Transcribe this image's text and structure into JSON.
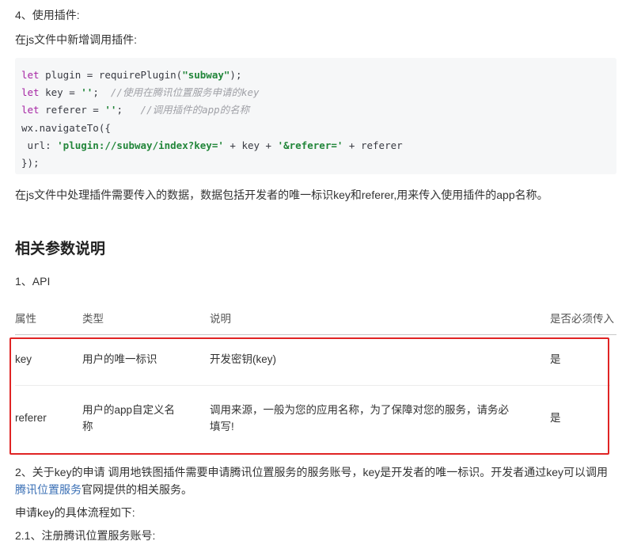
{
  "step4": {
    "title": "4、使用插件:",
    "desc": "在js文件中新增调用插件:"
  },
  "code": {
    "lines": [
      [
        {
          "t": "kw",
          "v": "let"
        },
        {
          "t": "p",
          "v": " plugin = requirePlugin("
        },
        {
          "t": "str",
          "v": "\"subway\""
        },
        {
          "t": "p",
          "v": ");"
        }
      ],
      [
        {
          "t": "kw",
          "v": "let"
        },
        {
          "t": "p",
          "v": " key = "
        },
        {
          "t": "str",
          "v": "''"
        },
        {
          "t": "p",
          "v": ";  "
        },
        {
          "t": "cm",
          "v": "//使用在腾讯位置服务申请的key"
        }
      ],
      [
        {
          "t": "kw",
          "v": "let"
        },
        {
          "t": "p",
          "v": " referer = "
        },
        {
          "t": "str",
          "v": "''"
        },
        {
          "t": "p",
          "v": ";   "
        },
        {
          "t": "cm",
          "v": "//调用插件的app的名称"
        }
      ],
      [
        {
          "t": "p",
          "v": "wx.navigateTo({"
        }
      ],
      [
        {
          "t": "p",
          "v": " url: "
        },
        {
          "t": "str",
          "v": "'plugin://subway/index?key='"
        },
        {
          "t": "p",
          "v": " + key + "
        },
        {
          "t": "str",
          "v": "'&referer='"
        },
        {
          "t": "p",
          "v": " + referer"
        }
      ],
      [
        {
          "t": "p",
          "v": "});"
        }
      ]
    ]
  },
  "after_code": "在js文件中处理插件需要传入的数据，数据包括开发者的唯一标识key和referer,用来传入使用插件的app名称。",
  "section_title": "相关参数说明",
  "api_label": "1、API",
  "table": {
    "headers": [
      "属性",
      "类型",
      "说明",
      "是否必须传入"
    ],
    "rows": [
      {
        "attr": "key",
        "type": "用户的唯一标识",
        "desc": "开发密钥(key)",
        "required": "是"
      },
      {
        "attr": "referer",
        "type": "用户的app自定义名称",
        "desc": "调用来源，一般为您的应用名称，为了保障对您的服务，请务必填写!",
        "required": "是"
      }
    ]
  },
  "para2": {
    "text_before": "2、关于key的申请 调用地铁图插件需要申请腾讯位置服务的服务账号，key是开发者的唯一标识。开发者通过key可以调用",
    "link": "腾讯位置服务",
    "text_after": "官网提供的相关服务。"
  },
  "flow": "申请key的具体流程如下:",
  "step21": "2.1、注册腾讯位置服务账号:",
  "colors": {
    "keyword": "#a626a4",
    "string": "#22863a",
    "comment": "#a0a1a7",
    "highlight_box": "#e02424",
    "link": "#3a6fb5"
  }
}
